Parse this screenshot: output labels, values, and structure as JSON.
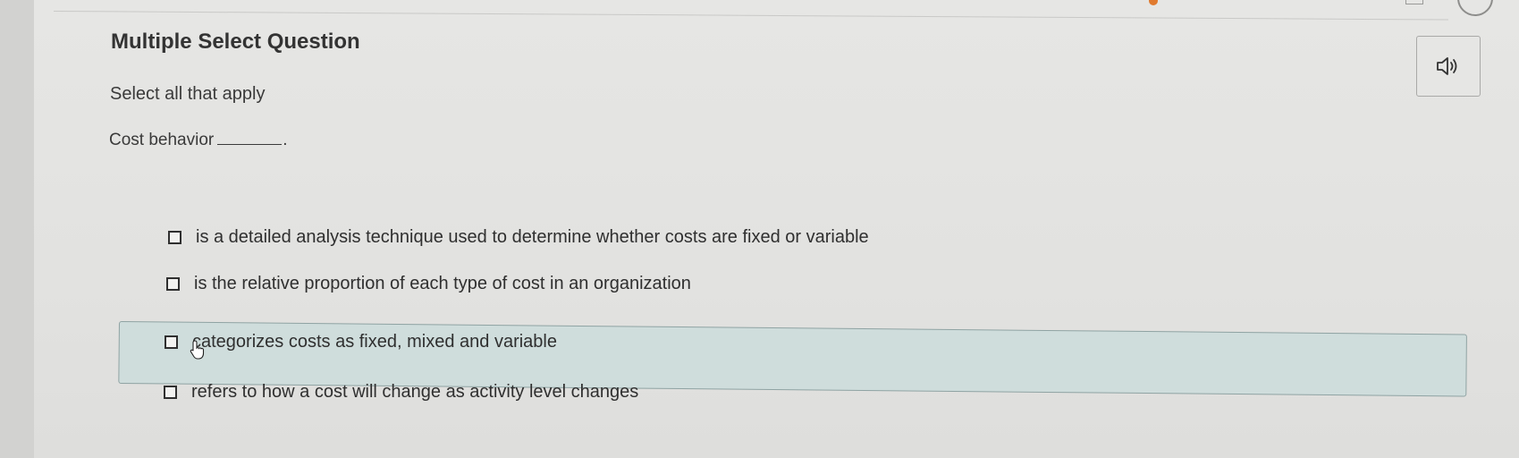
{
  "question": {
    "title": "Multiple Select Question",
    "instruction": "Select all that apply",
    "stem": "Cost behavior",
    "stem_end": "."
  },
  "audio_button": {
    "icon": "speaker-icon"
  },
  "options": [
    {
      "text": "is a detailed analysis technique used to determine whether costs are fixed or variable",
      "checked": false
    },
    {
      "text": "is the relative proportion of each type of cost in an organization",
      "checked": false
    },
    {
      "text": "categorizes costs as fixed, mixed and variable",
      "checked": false,
      "hovered": true
    },
    {
      "text": "refers to how a cost will change as activity level changes",
      "checked": false
    }
  ],
  "colors": {
    "hover_bg": "#cfdddc",
    "hover_border": "#8fa3a3",
    "text": "#2f2f2f"
  }
}
